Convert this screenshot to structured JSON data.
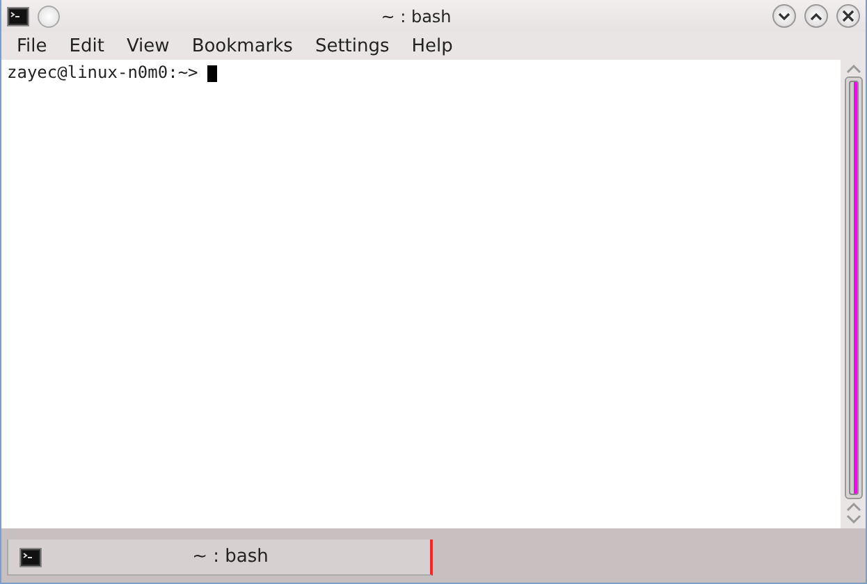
{
  "window": {
    "title": "~ : bash"
  },
  "menu": [
    "File",
    "Edit",
    "View",
    "Bookmarks",
    "Settings",
    "Help"
  ],
  "terminal": {
    "prompt": "zayec@linux-n0m0:~>"
  },
  "tabs": [
    {
      "label": "~ : bash",
      "selected": true
    }
  ]
}
